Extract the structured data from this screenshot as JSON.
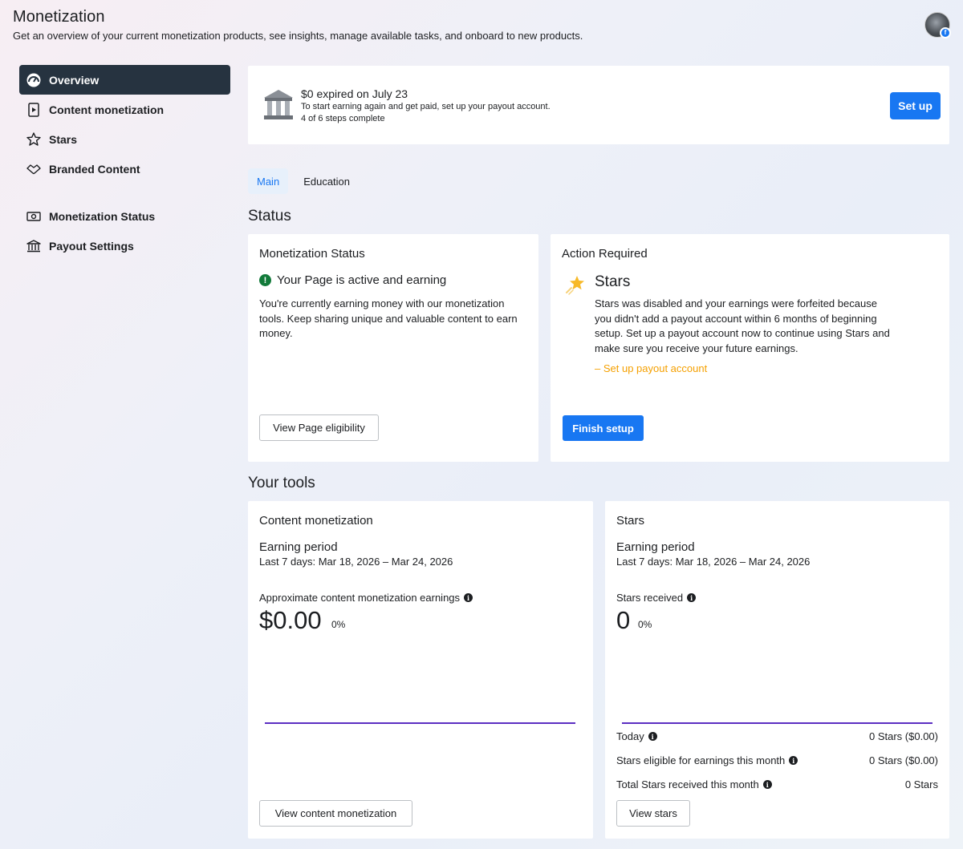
{
  "header": {
    "title": "Monetization",
    "subtitle": "Get an overview of your current monetization products, see insights, manage available tasks, and onboard to new products."
  },
  "sidebar": {
    "items": [
      {
        "label": "Overview",
        "icon": "dashboard-icon"
      },
      {
        "label": "Content monetization",
        "icon": "video-page-icon"
      },
      {
        "label": "Stars",
        "icon": "star-outline-icon"
      },
      {
        "label": "Branded Content",
        "icon": "handshake-icon"
      },
      {
        "label": "Monetization Status",
        "icon": "money-status-icon"
      },
      {
        "label": "Payout Settings",
        "icon": "bank-icon"
      }
    ]
  },
  "banner": {
    "title": "$0 expired on July 23",
    "line1": "To start earning again and get paid, set up your payout account.",
    "line2": "4 of 6 steps complete",
    "button": "Set up"
  },
  "tabs": [
    "Main",
    "Education"
  ],
  "sections": {
    "status": "Status",
    "tools": "Your tools"
  },
  "status_card": {
    "title": "Monetization Status",
    "headline": "Your Page is active and earning",
    "description": "You're currently earning money with our monetization tools. Keep sharing unique and valuable content to earn money.",
    "button": "View Page eligibility"
  },
  "action_card": {
    "title": "Action Required",
    "heading": "Stars",
    "description": "Stars was disabled and your earnings were forfeited because you didn't add a payout account within 6 months of beginning setup. Set up a payout account now to continue using Stars and make sure you receive your future earnings.",
    "step": "– Set up payout account",
    "button": "Finish setup"
  },
  "content_monetization_card": {
    "title": "Content monetization",
    "earning_period_label": "Earning period",
    "earning_period_range": "Last 7 days: Mar 18, 2026 – Mar 24, 2026",
    "metric_label": "Approximate content monetization earnings",
    "metric_value": "$0.00",
    "metric_change": "0%",
    "button": "View content monetization"
  },
  "stars_card": {
    "title": "Stars",
    "earning_period_label": "Earning period",
    "earning_period_range": "Last 7 days: Mar 18, 2026 – Mar 24, 2026",
    "metric_label": "Stars received",
    "metric_value": "0",
    "metric_change": "0%",
    "rows": [
      {
        "label": "Today",
        "value": "0 Stars ($0.00)"
      },
      {
        "label": "Stars eligible for earnings this month",
        "value": "0 Stars ($0.00)"
      },
      {
        "label": "Total Stars received this month",
        "value": "0 Stars"
      }
    ],
    "button": "View stars"
  },
  "colors": {
    "accent": "#1877f2",
    "nav_active": "#263340",
    "chart_line": "#5b2ec2",
    "success": "#127a3a",
    "warning_text": "#f5a000"
  }
}
